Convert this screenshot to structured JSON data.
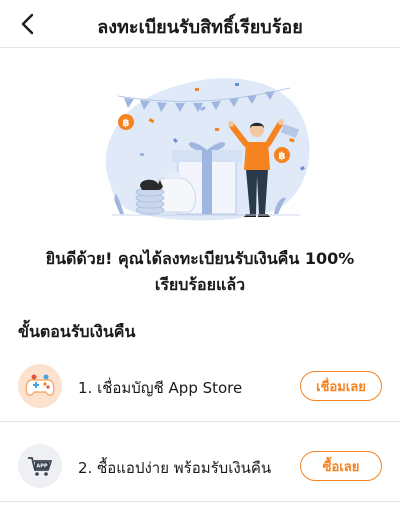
{
  "header": {
    "title": "ลงทะเบียนรับสิทธิ์เรียบร้อย",
    "back_icon": "chevron-left-icon"
  },
  "hero": {
    "illustration": "celebration-gift-illustration"
  },
  "message": {
    "line1": "ยินดีด้วย! คุณได้ลงทะเบียนรับเงินคืน 100%",
    "line2": "เรียบร้อยแล้ว"
  },
  "steps_section": {
    "title": "ขั้นตอนรับเงินคืน",
    "steps": [
      {
        "label": "1. เชื่อมบัญชี App Store",
        "button": "เชื่อมเลย",
        "icon": "game-controller-icon"
      },
      {
        "label": "2. ซื้อแอปง่าย พร้อมรับเงินคืน",
        "button": "ซื้อเลย",
        "icon": "app-cart-icon"
      }
    ]
  },
  "colors": {
    "accent": "#f5831f",
    "illustration_blue": "#dbe8f8",
    "divider": "#e6e3ee"
  }
}
